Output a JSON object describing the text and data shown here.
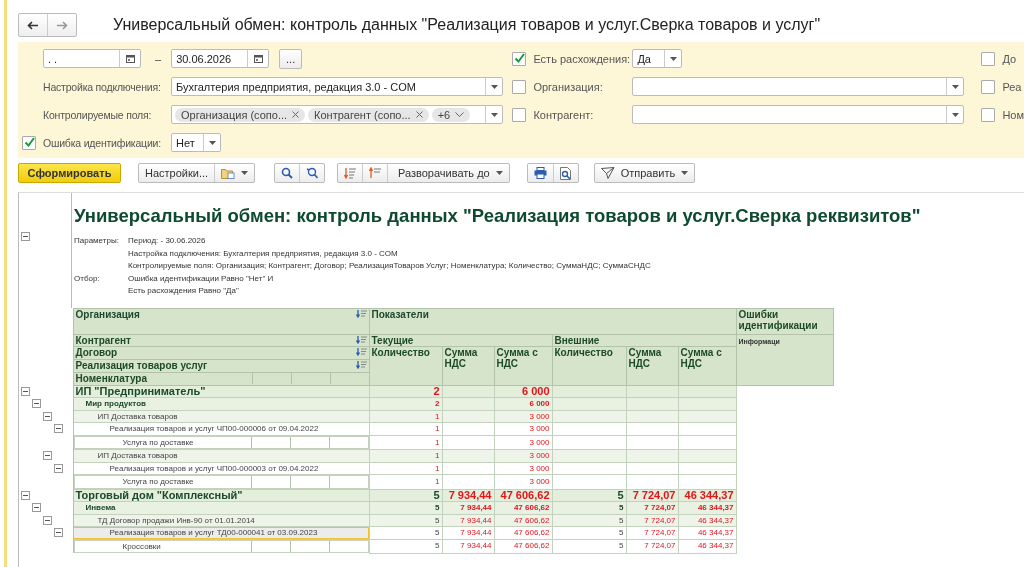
{
  "header": {
    "title": "Универсальный обмен: контроль данных \"Реализация товаров и услуг.Сверка товаров и услуг\""
  },
  "filters": {
    "period": {
      "from": ". .",
      "separator": "–",
      "to": "30.06.2026",
      "more": "..."
    },
    "left": [
      {
        "kind": "select",
        "label": "Настройка подключения:",
        "value": "Бухгалтерия предприятия, редакция 3.0 - COM"
      },
      {
        "kind": "tags",
        "label": "Контролируемые поля:",
        "tags": [
          "Организация (сопо...",
          "Контрагент (сопо..."
        ],
        "more": "+6"
      },
      {
        "kind": "check-select",
        "label": "Ошибка идентификации:",
        "checked": true,
        "value": "Нет"
      }
    ],
    "middle": [
      {
        "kind": "short-select",
        "label": "Есть расхождения:",
        "checked": true,
        "value": "Да"
      },
      {
        "kind": "select",
        "label": "Организация:",
        "checked": false
      },
      {
        "kind": "select",
        "label": "Контрагент:",
        "checked": false
      }
    ],
    "right": [
      {
        "label": "До",
        "checked": false
      },
      {
        "label": "Реа",
        "checked": false
      },
      {
        "label": "Ном",
        "checked": false
      }
    ]
  },
  "toolbar": {
    "generate": "Сформировать",
    "settings": "Настройки...",
    "expand": "Разворачивать до",
    "send": "Отправить"
  },
  "report": {
    "title": "Универсальный обмен: контроль данных \"Реализация товаров и услуг.Сверка реквизитов\"",
    "params": [
      {
        "label": "Параметры:",
        "lines": [
          "Период:  - 30.06.2026",
          "Настройка подключения:  Бухгалтерия предприятия, редакция 3.0 - COM",
          "Контролируемые поля:  Организация; Контрагент; Договор; РеализацияТоваров Услуг; Номенклатура; Количество; СуммаНДС; СуммаСНДС"
        ]
      },
      {
        "label": "Отбор:",
        "lines": [
          "Ошибка идентификации Равно \"Нет\" И",
          "Есть расхождения Равно \"Да\""
        ]
      }
    ],
    "groups": [
      {
        "label": "Организация",
        "sortable": true
      },
      {
        "label": "Контрагент",
        "sortable": true
      },
      {
        "label": "Договор",
        "sortable": true
      },
      {
        "label": "Реализация товаров услуг",
        "sortable": true
      },
      {
        "label": "Номенклатура",
        "sortable": false
      }
    ],
    "indicators": "Показатели",
    "current": {
      "label": "Текущие",
      "measures": [
        "Количество",
        "Сумма НДС",
        "Сумма с НДС"
      ]
    },
    "external": {
      "label": "Внешние",
      "measures": [
        "Количество",
        "Сумма НДС",
        "Сумма с НДС"
      ]
    },
    "errors": "Ошибки идентификации",
    "errors_sub": "Информаци",
    "rows": [
      {
        "label": "ИП \"Предприниматель\"",
        "selected": false,
        "cells": [
          {
            "text": "2",
            "mismatch": true
          },
          null,
          {
            "text": "6 000",
            "mismatch": true
          },
          null,
          null,
          null
        ],
        "children": [
          {
            "label": "Мир продуктов",
            "selected": false,
            "cells": [
              {
                "text": "2",
                "mismatch": true
              },
              null,
              {
                "text": "6 000",
                "mismatch": true
              },
              null,
              null,
              null
            ],
            "children": [
              {
                "label": "ИП Доставка товаров",
                "selected": false,
                "cells": [
                  {
                    "text": "1",
                    "mismatch": true
                  },
                  null,
                  {
                    "text": "3 000",
                    "mismatch": true
                  },
                  null,
                  null,
                  null
                ],
                "children": [
                  {
                    "label": "Реализация товаров и услуг ЧП00-000006 от 09.04.2022",
                    "selected": false,
                    "cells": [
                      {
                        "text": "1",
                        "mismatch": true
                      },
                      null,
                      {
                        "text": "3 000",
                        "mismatch": true
                      },
                      null,
                      null,
                      null
                    ],
                    "children": [
                      {
                        "label": "Услуга по доставке",
                        "selected": false,
                        "cells": [
                          {
                            "text": "1",
                            "mismatch": true
                          },
                          null,
                          {
                            "text": "3 000",
                            "mismatch": true
                          },
                          null,
                          null,
                          null
                        ]
                      }
                    ]
                  }
                ]
              },
              {
                "label": "ИП Доставка товаров",
                "selected": false,
                "cells": [
                  {
                    "text": "1",
                    "mismatch": true
                  },
                  null,
                  {
                    "text": "3 000",
                    "mismatch": true
                  },
                  null,
                  null,
                  null
                ],
                "children": [
                  {
                    "label": "Реализация товаров и услуг ЧП00-000003 от 09.04.2022",
                    "selected": false,
                    "cells": [
                      {
                        "text": "1",
                        "mismatch": true
                      },
                      null,
                      {
                        "text": "3 000",
                        "mismatch": true
                      },
                      null,
                      null,
                      null
                    ],
                    "children": [
                      {
                        "label": "Услуга по доставке",
                        "selected": false,
                        "cells": [
                          {
                            "text": "1",
                            "mismatch": true
                          },
                          null,
                          {
                            "text": "3 000",
                            "mismatch": true
                          },
                          null,
                          null,
                          null
                        ]
                      }
                    ]
                  }
                ]
              }
            ]
          }
        ]
      },
      {
        "label": "Торговый дом \"Комплексный\"",
        "selected": false,
        "cells": [
          {
            "text": "5",
            "mismatch": false
          },
          {
            "text": "7 934,44",
            "mismatch": true
          },
          {
            "text": "47 606,62",
            "mismatch": true
          },
          {
            "text": "5",
            "mismatch": false
          },
          {
            "text": "7 724,07",
            "mismatch": true
          },
          {
            "text": "46 344,37",
            "mismatch": true
          }
        ],
        "children": [
          {
            "label": "Инвема",
            "selected": false,
            "cells": [
              {
                "text": "5",
                "mismatch": false
              },
              {
                "text": "7 934,44",
                "mismatch": true
              },
              {
                "text": "47 606,62",
                "mismatch": true
              },
              {
                "text": "5",
                "mismatch": false
              },
              {
                "text": "7 724,07",
                "mismatch": true
              },
              {
                "text": "46 344,37",
                "mismatch": true
              }
            ],
            "children": [
              {
                "label": "ТД Договор продажи Инв-90 от 01.01.2014",
                "selected": false,
                "cells": [
                  {
                    "text": "5",
                    "mismatch": false
                  },
                  {
                    "text": "7 934,44",
                    "mismatch": true
                  },
                  {
                    "text": "47 606,62",
                    "mismatch": true
                  },
                  {
                    "text": "5",
                    "mismatch": false
                  },
                  {
                    "text": "7 724,07",
                    "mismatch": true
                  },
                  {
                    "text": "46 344,37",
                    "mismatch": true
                  }
                ],
                "children": [
                  {
                    "label": "Реализация товаров и услуг ТД00-000041 от 03.09.2023",
                    "selected": true,
                    "cells": [
                      {
                        "text": "5",
                        "mismatch": false
                      },
                      {
                        "text": "7 934,44",
                        "mismatch": true
                      },
                      {
                        "text": "47 606,62",
                        "mismatch": true
                      },
                      {
                        "text": "5",
                        "mismatch": false
                      },
                      {
                        "text": "7 724,07",
                        "mismatch": true
                      },
                      {
                        "text": "46 344,37",
                        "mismatch": true
                      }
                    ],
                    "children": [
                      {
                        "label": "Кроссовки",
                        "selected": false,
                        "cells": [
                          {
                            "text": "5",
                            "mismatch": false
                          },
                          {
                            "text": "7 934,44",
                            "mismatch": true
                          },
                          {
                            "text": "47 606,62",
                            "mismatch": true
                          },
                          {
                            "text": "5",
                            "mismatch": false
                          },
                          {
                            "text": "7 724,07",
                            "mismatch": true
                          },
                          {
                            "text": "46 344,37",
                            "mismatch": true
                          }
                        ]
                      }
                    ]
                  }
                ]
              }
            ]
          }
        ]
      }
    ]
  }
}
